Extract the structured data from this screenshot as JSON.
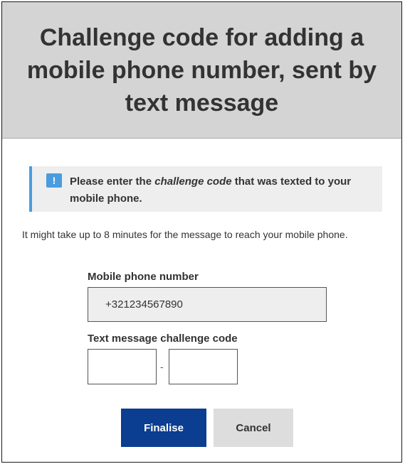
{
  "header": {
    "title": "Challenge code for adding a\nmobile phone number, sent by\ntext message"
  },
  "notice": {
    "icon": "exclamation-icon",
    "text_before": "Please enter the ",
    "text_emphasis": "challenge code",
    "text_after": " that was texted to your mobile phone."
  },
  "info": {
    "text": "It might take up to 8 minutes for the message to reach your mobile phone."
  },
  "form": {
    "phone_label": "Mobile phone number",
    "phone_value": "+321234567890",
    "code_label": "Text message challenge code",
    "code_part1": "",
    "code_part2": "",
    "code_separator": "-"
  },
  "buttons": {
    "finalise": "Finalise",
    "cancel": "Cancel"
  },
  "colors": {
    "header_bg": "#d4d4d4",
    "accent_blue": "#4a9cdf",
    "primary_button": "#0b3d91",
    "secondary_button": "#dddddd"
  }
}
